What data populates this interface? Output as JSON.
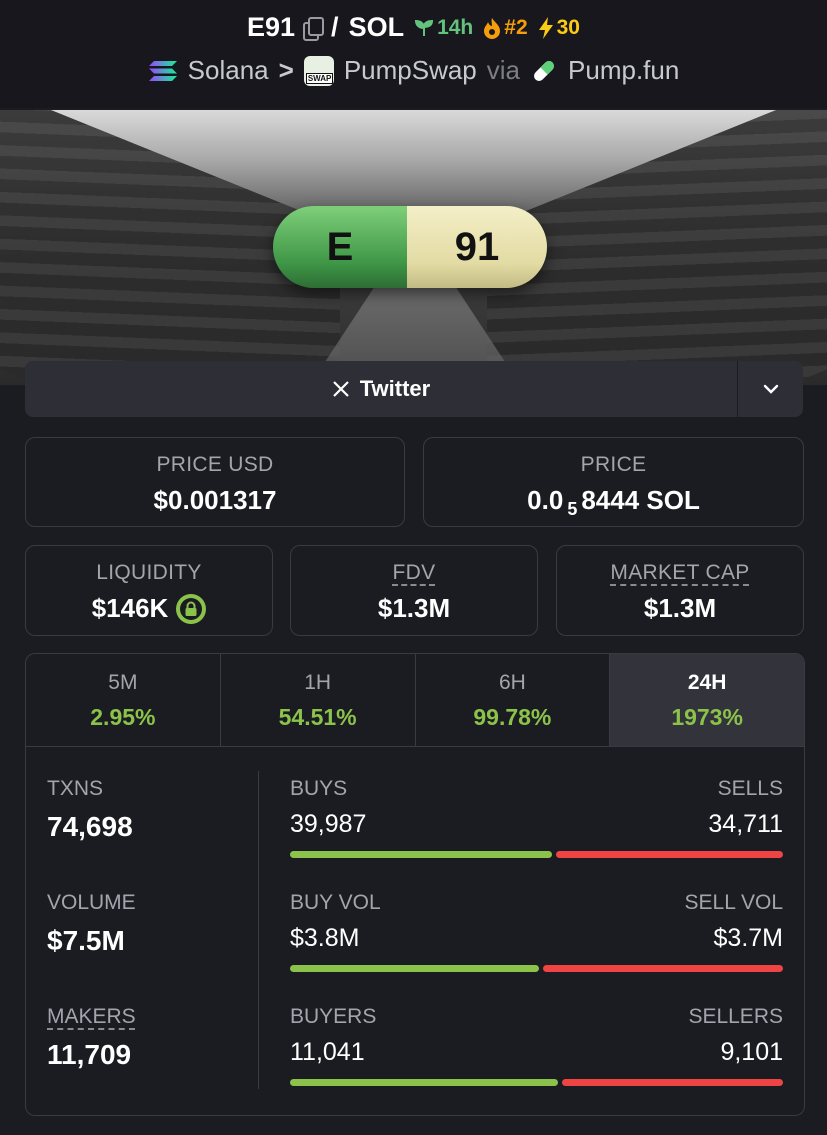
{
  "header": {
    "token_symbol": "E91",
    "slash": "/",
    "quote_symbol": "SOL",
    "age": "14h",
    "rank": "#2",
    "boosts": "30",
    "chain": "Solana",
    "chevron": ">",
    "dex": "PumpSwap",
    "via": "via",
    "launchpad": "Pump.fun",
    "swap_badge": "SWAP"
  },
  "banner": {
    "pill_left": "E",
    "pill_right": "91"
  },
  "links": {
    "twitter_label": "Twitter"
  },
  "price": {
    "usd_label": "PRICE USD",
    "usd_value": "$0.001317",
    "native_label": "PRICE",
    "native_prefix": "0.0",
    "native_zeros": "5",
    "native_digits": "8444 SOL"
  },
  "metrics": {
    "liquidity_label": "LIQUIDITY",
    "liquidity_value": "$146K",
    "fdv_label": "FDV",
    "fdv_value": "$1.3M",
    "mcap_label": "MARKET CAP",
    "mcap_value": "$1.3M"
  },
  "tabs": [
    {
      "label": "5M",
      "value": "2.95%"
    },
    {
      "label": "1H",
      "value": "54.51%"
    },
    {
      "label": "6H",
      "value": "99.78%"
    },
    {
      "label": "24H",
      "value": "1973%",
      "active": true
    }
  ],
  "stats": {
    "txns_label": "TXNS",
    "txns_value": "74,698",
    "volume_label": "VOLUME",
    "volume_value": "$7.5M",
    "makers_label": "MAKERS",
    "makers_value": "11,709",
    "buys_label": "BUYS",
    "buys_value": "39,987",
    "sells_label": "SELLS",
    "sells_value": "34,711",
    "buys_ratio": 0.535,
    "buyvol_label": "BUY VOL",
    "buyvol_value": "$3.8M",
    "sellvol_label": "SELL VOL",
    "sellvol_value": "$3.7M",
    "buyvol_ratio": 0.51,
    "buyers_label": "BUYERS",
    "buyers_value": "11,041",
    "sellers_label": "SELLERS",
    "sellers_value": "9,101",
    "buyers_ratio": 0.548
  },
  "colors": {
    "positive": "#8bc34a",
    "negative": "#ef4444",
    "age": "#63c27c",
    "rank": "#f59e0b",
    "boost": "#facc15"
  }
}
